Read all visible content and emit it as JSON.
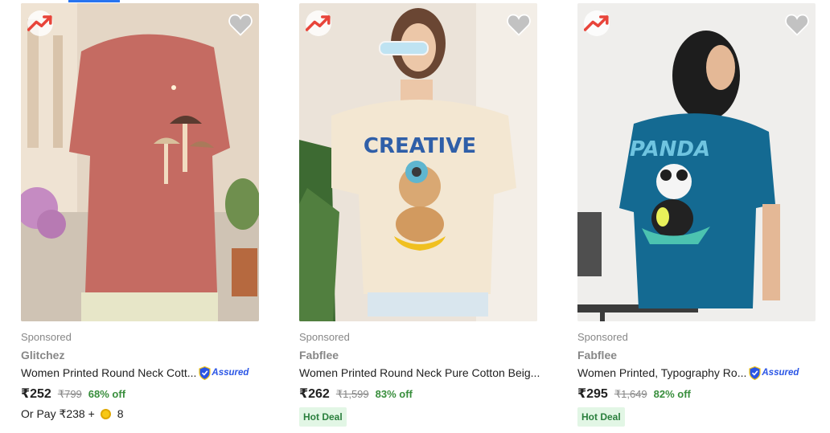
{
  "products": [
    {
      "sponsored": "Sponsored",
      "brand": "Glitchez",
      "title": "Women Printed Round Neck Cott...",
      "assured": "Assured",
      "price": "₹252",
      "mrp": "₹799",
      "discount": "68% off",
      "or_pay_prefix": "Or Pay ₹238 +",
      "coins": "8",
      "badge": "",
      "shirt_color": "#c56b62",
      "bg_color": "#d9c6b2",
      "print_text": ""
    },
    {
      "sponsored": "Sponsored",
      "brand": "Fabflee",
      "title": "Women Printed Round Neck Pure Cotton Beig...",
      "assured": "",
      "price": "₹262",
      "mrp": "₹1,599",
      "discount": "83% off",
      "or_pay_prefix": "",
      "coins": "",
      "badge": "Hot Deal",
      "shirt_color": "#f3e7d2",
      "bg_color": "#e8e0d6",
      "print_text": "CREATIVE"
    },
    {
      "sponsored": "Sponsored",
      "brand": "Fabflee",
      "title": "Women Printed, Typography Ro...",
      "assured": "Assured",
      "price": "₹295",
      "mrp": "₹1,649",
      "discount": "82% off",
      "or_pay_prefix": "",
      "coins": "",
      "badge": "Hot Deal",
      "shirt_color": "#146a92",
      "bg_color": "#ecebe8",
      "print_text": "PANDA"
    }
  ],
  "icons": {
    "trend": "trending-up-icon",
    "wishlist": "heart-icon",
    "assured": "assured-shield-icon",
    "coin": "supercoin-icon"
  },
  "colors": {
    "trend_red": "#e8443a",
    "heart_grey": "#c2c2c2",
    "discount_green": "#388e3c",
    "assured_blue": "#2a55e5",
    "deal_bg": "#e2f6e5"
  }
}
